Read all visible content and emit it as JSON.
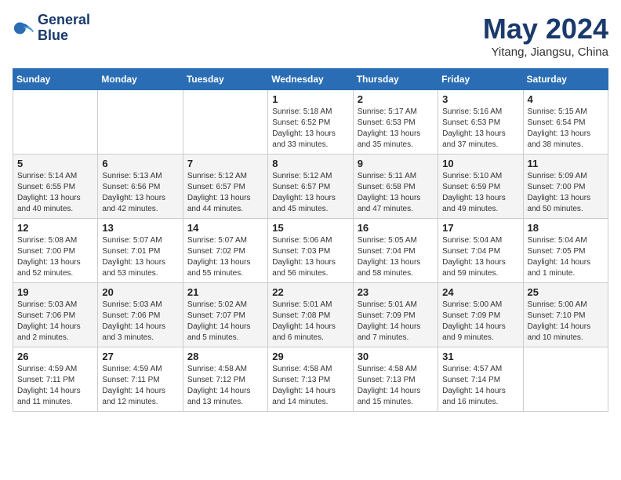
{
  "header": {
    "logo_line1": "General",
    "logo_line2": "Blue",
    "title": "May 2024",
    "subtitle": "Yitang, Jiangsu, China"
  },
  "days_of_week": [
    "Sunday",
    "Monday",
    "Tuesday",
    "Wednesday",
    "Thursday",
    "Friday",
    "Saturday"
  ],
  "weeks": [
    [
      {
        "day": "",
        "info": ""
      },
      {
        "day": "",
        "info": ""
      },
      {
        "day": "",
        "info": ""
      },
      {
        "day": "1",
        "info": "Sunrise: 5:18 AM\nSunset: 6:52 PM\nDaylight: 13 hours\nand 33 minutes."
      },
      {
        "day": "2",
        "info": "Sunrise: 5:17 AM\nSunset: 6:53 PM\nDaylight: 13 hours\nand 35 minutes."
      },
      {
        "day": "3",
        "info": "Sunrise: 5:16 AM\nSunset: 6:53 PM\nDaylight: 13 hours\nand 37 minutes."
      },
      {
        "day": "4",
        "info": "Sunrise: 5:15 AM\nSunset: 6:54 PM\nDaylight: 13 hours\nand 38 minutes."
      }
    ],
    [
      {
        "day": "5",
        "info": "Sunrise: 5:14 AM\nSunset: 6:55 PM\nDaylight: 13 hours\nand 40 minutes."
      },
      {
        "day": "6",
        "info": "Sunrise: 5:13 AM\nSunset: 6:56 PM\nDaylight: 13 hours\nand 42 minutes."
      },
      {
        "day": "7",
        "info": "Sunrise: 5:12 AM\nSunset: 6:57 PM\nDaylight: 13 hours\nand 44 minutes."
      },
      {
        "day": "8",
        "info": "Sunrise: 5:12 AM\nSunset: 6:57 PM\nDaylight: 13 hours\nand 45 minutes."
      },
      {
        "day": "9",
        "info": "Sunrise: 5:11 AM\nSunset: 6:58 PM\nDaylight: 13 hours\nand 47 minutes."
      },
      {
        "day": "10",
        "info": "Sunrise: 5:10 AM\nSunset: 6:59 PM\nDaylight: 13 hours\nand 49 minutes."
      },
      {
        "day": "11",
        "info": "Sunrise: 5:09 AM\nSunset: 7:00 PM\nDaylight: 13 hours\nand 50 minutes."
      }
    ],
    [
      {
        "day": "12",
        "info": "Sunrise: 5:08 AM\nSunset: 7:00 PM\nDaylight: 13 hours\nand 52 minutes."
      },
      {
        "day": "13",
        "info": "Sunrise: 5:07 AM\nSunset: 7:01 PM\nDaylight: 13 hours\nand 53 minutes."
      },
      {
        "day": "14",
        "info": "Sunrise: 5:07 AM\nSunset: 7:02 PM\nDaylight: 13 hours\nand 55 minutes."
      },
      {
        "day": "15",
        "info": "Sunrise: 5:06 AM\nSunset: 7:03 PM\nDaylight: 13 hours\nand 56 minutes."
      },
      {
        "day": "16",
        "info": "Sunrise: 5:05 AM\nSunset: 7:04 PM\nDaylight: 13 hours\nand 58 minutes."
      },
      {
        "day": "17",
        "info": "Sunrise: 5:04 AM\nSunset: 7:04 PM\nDaylight: 13 hours\nand 59 minutes."
      },
      {
        "day": "18",
        "info": "Sunrise: 5:04 AM\nSunset: 7:05 PM\nDaylight: 14 hours\nand 1 minute."
      }
    ],
    [
      {
        "day": "19",
        "info": "Sunrise: 5:03 AM\nSunset: 7:06 PM\nDaylight: 14 hours\nand 2 minutes."
      },
      {
        "day": "20",
        "info": "Sunrise: 5:03 AM\nSunset: 7:06 PM\nDaylight: 14 hours\nand 3 minutes."
      },
      {
        "day": "21",
        "info": "Sunrise: 5:02 AM\nSunset: 7:07 PM\nDaylight: 14 hours\nand 5 minutes."
      },
      {
        "day": "22",
        "info": "Sunrise: 5:01 AM\nSunset: 7:08 PM\nDaylight: 14 hours\nand 6 minutes."
      },
      {
        "day": "23",
        "info": "Sunrise: 5:01 AM\nSunset: 7:09 PM\nDaylight: 14 hours\nand 7 minutes."
      },
      {
        "day": "24",
        "info": "Sunrise: 5:00 AM\nSunset: 7:09 PM\nDaylight: 14 hours\nand 9 minutes."
      },
      {
        "day": "25",
        "info": "Sunrise: 5:00 AM\nSunset: 7:10 PM\nDaylight: 14 hours\nand 10 minutes."
      }
    ],
    [
      {
        "day": "26",
        "info": "Sunrise: 4:59 AM\nSunset: 7:11 PM\nDaylight: 14 hours\nand 11 minutes."
      },
      {
        "day": "27",
        "info": "Sunrise: 4:59 AM\nSunset: 7:11 PM\nDaylight: 14 hours\nand 12 minutes."
      },
      {
        "day": "28",
        "info": "Sunrise: 4:58 AM\nSunset: 7:12 PM\nDaylight: 14 hours\nand 13 minutes."
      },
      {
        "day": "29",
        "info": "Sunrise: 4:58 AM\nSunset: 7:13 PM\nDaylight: 14 hours\nand 14 minutes."
      },
      {
        "day": "30",
        "info": "Sunrise: 4:58 AM\nSunset: 7:13 PM\nDaylight: 14 hours\nand 15 minutes."
      },
      {
        "day": "31",
        "info": "Sunrise: 4:57 AM\nSunset: 7:14 PM\nDaylight: 14 hours\nand 16 minutes."
      },
      {
        "day": "",
        "info": ""
      }
    ]
  ]
}
